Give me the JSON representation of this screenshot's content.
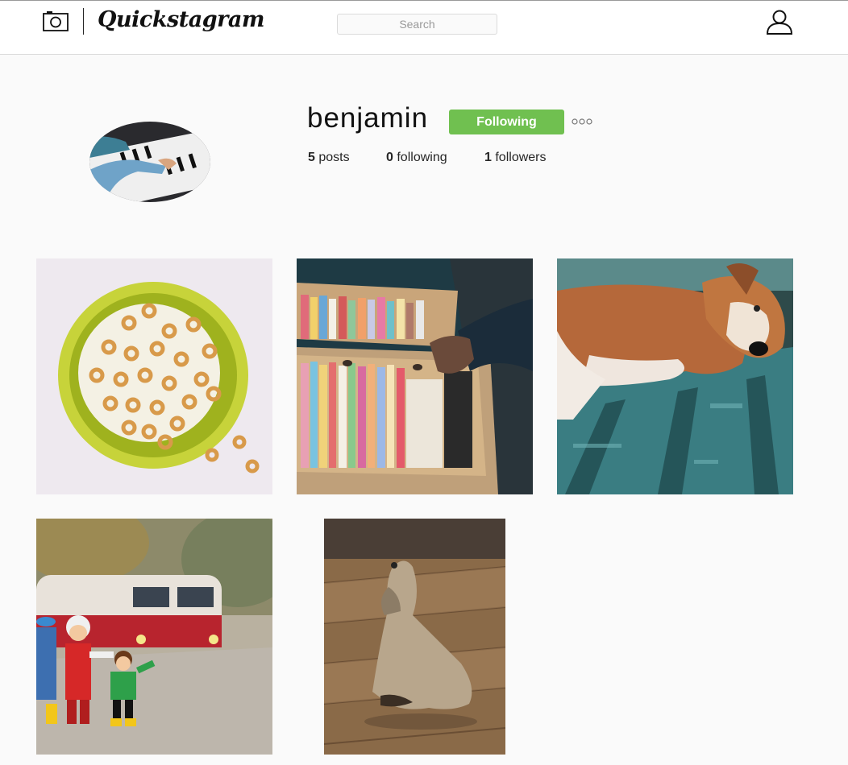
{
  "header": {
    "logo": "Quickstagram",
    "search_placeholder": "Search"
  },
  "profile": {
    "username": "benjamin",
    "follow_label": "Following",
    "posts_count": "5",
    "posts_label": "posts",
    "following_count": "0",
    "following_label": "following",
    "followers_count": "1",
    "followers_label": "followers"
  },
  "posts": [
    {
      "subject": "cereal bowl"
    },
    {
      "subject": "record crates"
    },
    {
      "subject": "dog on bench"
    },
    {
      "subject": "toy figures"
    },
    {
      "subject": "fluffy dog"
    }
  ],
  "colors": {
    "accent": "#70c050",
    "background": "#fafafa"
  }
}
